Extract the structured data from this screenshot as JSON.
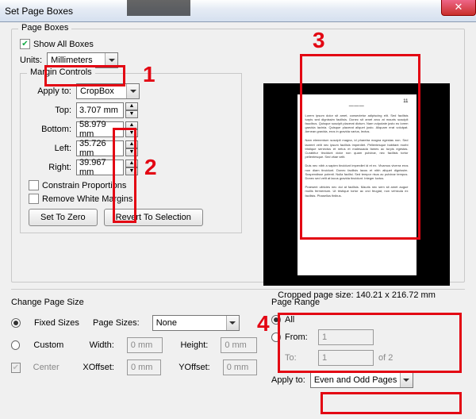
{
  "window": {
    "title": "Set Page Boxes"
  },
  "pageboxes": {
    "legend": "Page Boxes",
    "show_all_label": "Show All Boxes",
    "units_label": "Units:",
    "units_value": "Millimeters"
  },
  "margin": {
    "legend": "Margin Controls",
    "apply_to_label": "Apply to:",
    "apply_to_value": "CropBox",
    "top_label": "Top:",
    "top_value": "3.707 mm",
    "bottom_label": "Bottom:",
    "bottom_value": "58.979 mm",
    "left_label": "Left:",
    "left_value": "35.726 mm",
    "right_label": "Right:",
    "right_value": "39.967 mm",
    "constrain_label": "Constrain Proportions",
    "remove_white_label": "Remove White Margins",
    "set_zero": "Set To Zero",
    "revert": "Revert To Selection"
  },
  "preview": {
    "cropped_info": "Cropped page size: 140.21 x 216.72 mm"
  },
  "changesize": {
    "legend": "Change Page Size",
    "fixed_label": "Fixed Sizes",
    "custom_label": "Custom",
    "center_label": "Center",
    "pagesizes_label": "Page Sizes:",
    "pagesizes_value": "None",
    "width_label": "Width:",
    "width_value": "0 mm",
    "height_label": "Height:",
    "height_value": "0 mm",
    "xoffset_label": "XOffset:",
    "xoffset_value": "0 mm",
    "yoffset_label": "YOffset:",
    "yoffset_value": "0 mm"
  },
  "pagerange": {
    "legend": "Page Range",
    "all_label": "All",
    "from_label": "From:",
    "from_value": "1",
    "to_label": "To:",
    "to_value": "1",
    "of_label": "of 2",
    "apply_to_label": "Apply to:",
    "apply_to_value": "Even and Odd Pages"
  },
  "annotations": {
    "n1": "1",
    "n2": "2",
    "n3": "3",
    "n4": "4"
  }
}
